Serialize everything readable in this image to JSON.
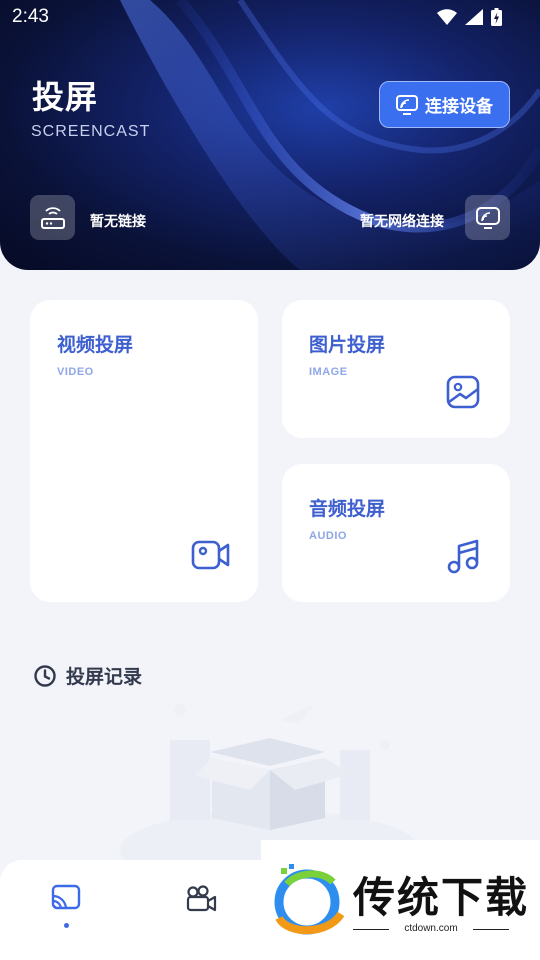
{
  "status_bar": {
    "time": "2:43"
  },
  "header": {
    "title": "投屏",
    "subtitle": "SCREENCAST",
    "connect_button_label": "连接设备",
    "left_status": "暂无链接",
    "right_status": "暂无网络连接"
  },
  "cards": {
    "video": {
      "title": "视频投屏",
      "sub": "VIDEO"
    },
    "image": {
      "title": "图片投屏",
      "sub": "IMAGE"
    },
    "audio": {
      "title": "音频投屏",
      "sub": "AUDIO"
    }
  },
  "history": {
    "title": "投屏记录"
  },
  "watermark": {
    "text": "传统下载",
    "url": "ctdown.com"
  },
  "colors": {
    "accent": "#3d5fcf",
    "button": "#3a6ff0",
    "background": "#f2f4fa"
  },
  "icons": [
    "wifi-icon",
    "signal-icon",
    "battery-icon",
    "cast-icon",
    "router-icon",
    "video-camera-icon",
    "image-icon",
    "music-icon",
    "clock-icon",
    "movie-camera-icon"
  ]
}
